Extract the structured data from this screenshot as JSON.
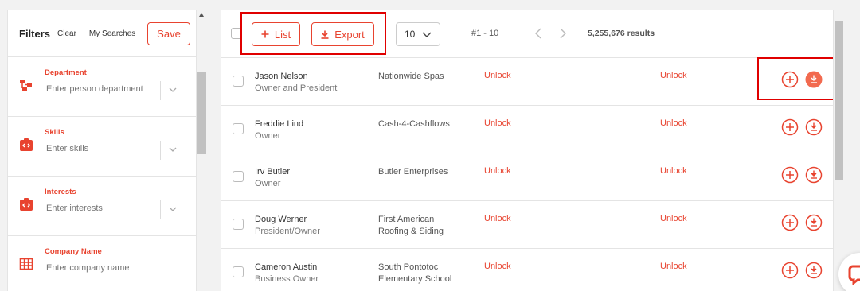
{
  "filters": {
    "title": "Filters",
    "clear_label": "Clear",
    "my_searches_label": "My Searches",
    "save_label": "Save",
    "sections": [
      {
        "label": "Department",
        "placeholder": "Enter person department",
        "icon": "department-icon",
        "has_dropdown": true
      },
      {
        "label": "Skills",
        "placeholder": "Enter skills",
        "icon": "skills-badge-icon",
        "has_dropdown": true
      },
      {
        "label": "Interests",
        "placeholder": "Enter interests",
        "icon": "interests-badge-icon",
        "has_dropdown": true
      },
      {
        "label": "Company Name",
        "placeholder": "Enter company name",
        "icon": "building-icon",
        "has_dropdown": false
      }
    ]
  },
  "toolbar": {
    "list_label": "List",
    "export_label": "Export",
    "per_page": "10",
    "range": "#1 - 10",
    "total_results": "5,255,676 results"
  },
  "results": [
    {
      "name": "Jason Nelson",
      "title": "Owner and President",
      "company": "Nationwide Spas",
      "email": "Unlock",
      "phone": "Unlock",
      "download_active": true
    },
    {
      "name": "Freddie Lind",
      "title": "Owner",
      "company": "Cash-4-Cashflows",
      "email": "Unlock",
      "phone": "Unlock",
      "download_active": false
    },
    {
      "name": "Irv Butler",
      "title": "Owner",
      "company": "Butler Enterprises",
      "email": "Unlock",
      "phone": "Unlock",
      "download_active": false
    },
    {
      "name": "Doug Werner",
      "title": "President/Owner",
      "company": "First American Roofing & Siding",
      "email": "Unlock",
      "phone": "Unlock",
      "download_active": false
    },
    {
      "name": "Cameron Austin",
      "title": "Business Owner",
      "company": "South Pontotoc Elementary School",
      "email": "Unlock",
      "phone": "Unlock",
      "download_active": false
    }
  ],
  "colors": {
    "accent": "#e8432f",
    "accent_filled": "#f26a4f",
    "highlight": "#e00000"
  }
}
